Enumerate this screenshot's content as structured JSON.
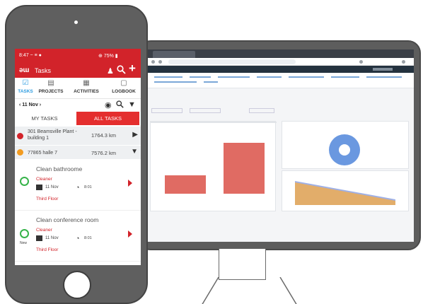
{
  "phone": {
    "status": {
      "left": "8:47 ~ ≡ ●",
      "right": "⊕ 75% ▮"
    },
    "appbar": {
      "logo": "ǝɯ",
      "title": "Tasks",
      "icons": [
        "person-icon",
        "search-icon",
        "plus-icon"
      ]
    },
    "tabs": [
      {
        "label": "TASKS",
        "icon": "checklist-icon",
        "active": true
      },
      {
        "label": "PROJECTS",
        "icon": "clipboard-icon"
      },
      {
        "label": "ACTIVITIES",
        "icon": "calendar-icon"
      },
      {
        "label": "LOGBOOK",
        "icon": "book-icon"
      }
    ],
    "date": {
      "label": "11 Nov"
    },
    "segments": {
      "my": "MY TASKS",
      "all": "ALL TASKS"
    },
    "sites": [
      {
        "name": "301 Beamsville Plant - building 1",
        "distance": "1764.3 km",
        "color": "#d2232a"
      },
      {
        "name": "77865 halle 7",
        "distance": "7576.2 km",
        "color": "#f29b20"
      }
    ],
    "tasks": [
      {
        "title": "Clean bathroome",
        "role": "Cleaner",
        "date": "11 Nov",
        "time": "8:01",
        "floor": "Third Floor",
        "badge": ""
      },
      {
        "title": "Clean conference room",
        "role": "Cleaner",
        "date": "11 Nov",
        "time": "8:01",
        "floor": "Third Floor",
        "badge": "New"
      }
    ]
  },
  "desktop": {
    "colors": {
      "bar": "#e06b63",
      "donut": "#6a98e0",
      "area_a": "#e2ad6a",
      "area_b": "#9fb0e6"
    },
    "bars": [
      0.28,
      0.78
    ]
  }
}
